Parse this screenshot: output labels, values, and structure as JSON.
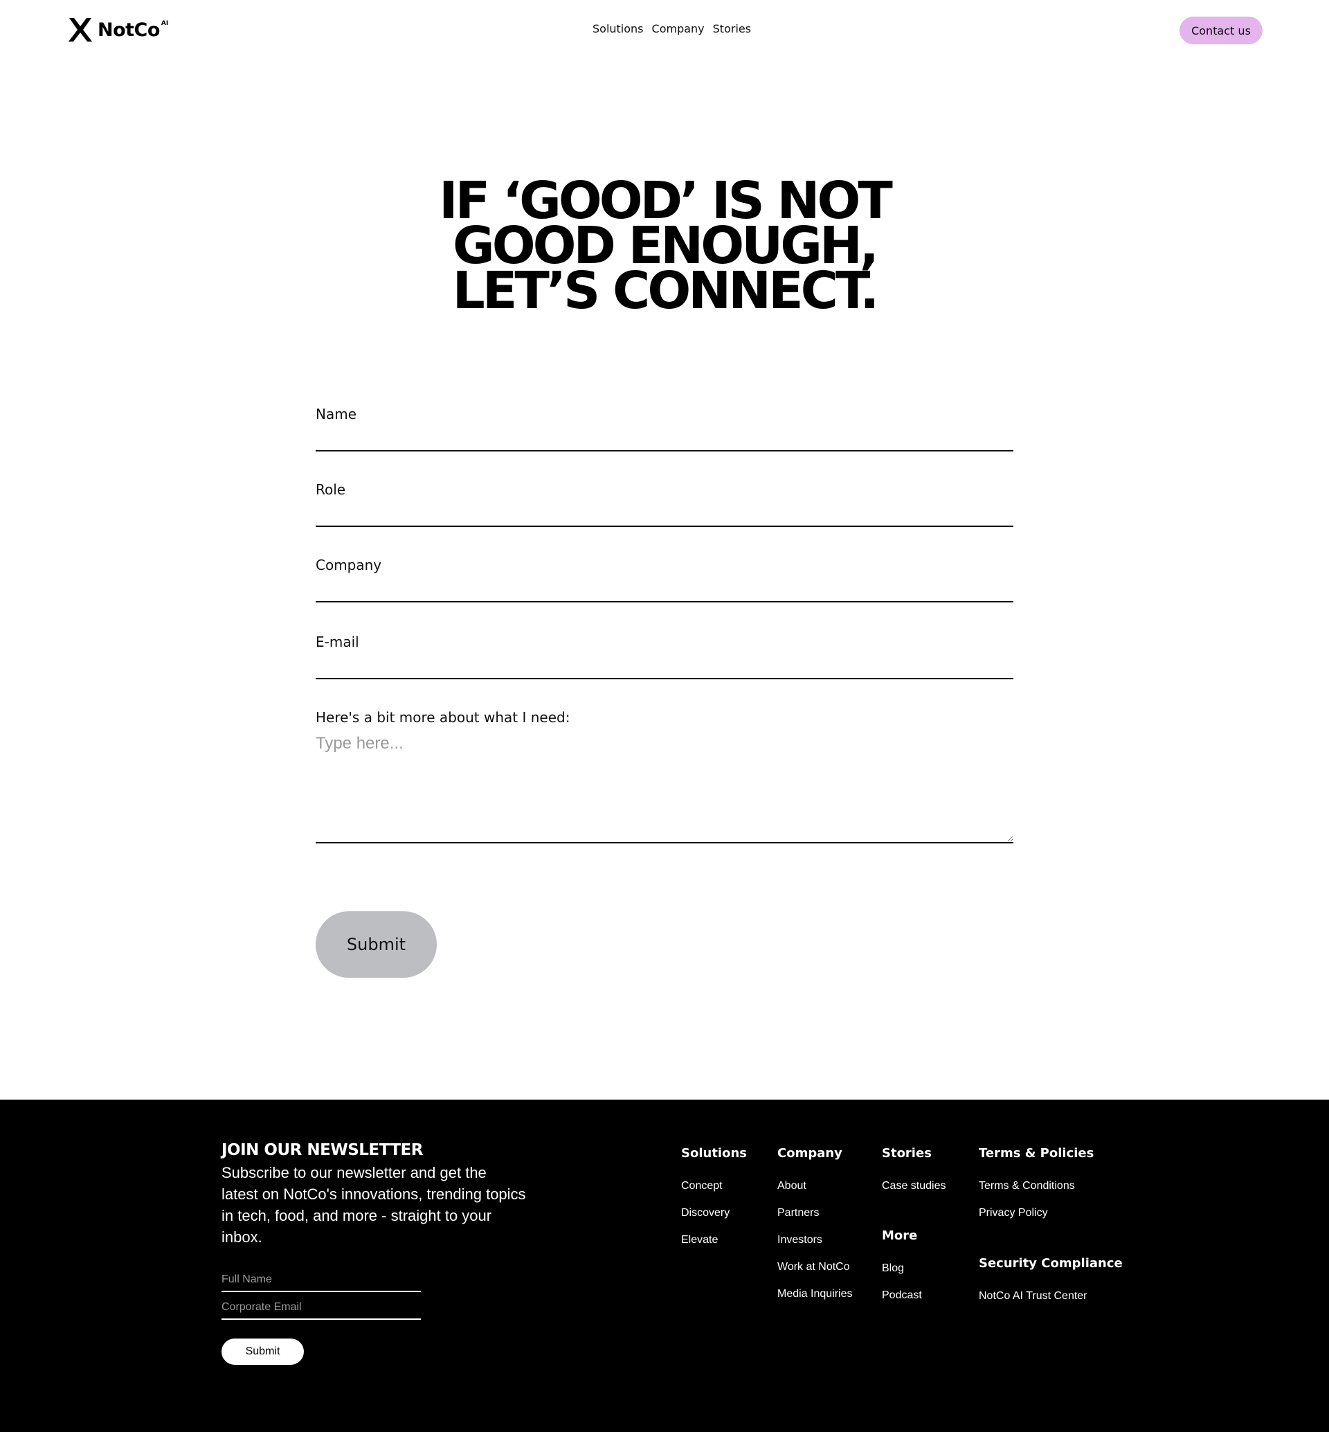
{
  "header": {
    "brand": "NotCo",
    "brand_sup": "AI",
    "nav": [
      "Solutions",
      "Company",
      "Stories"
    ],
    "contact_label": "Contact us"
  },
  "hero": {
    "line1": "IF ‘GOOD’ IS NOT",
    "line2": "GOOD ENOUGH,",
    "line3": "LET’S CONNECT."
  },
  "form": {
    "name_label": "Name",
    "role_label": "Role",
    "company_label": "Company",
    "email_label": "E-mail",
    "message_label": "Here's a bit more about what I need:",
    "message_placeholder": "Type here...",
    "submit_label": "Submit"
  },
  "footer": {
    "newsletter_title": "JOIN OUR NEWSLETTER",
    "newsletter_desc": "Subscribe to our newsletter and get the latest on NotCo's innovations, trending topics in tech, food, and more - straight to your inbox.",
    "fullname_placeholder": "Full Name",
    "email_placeholder": "Corporate Email",
    "submit_label": "Submit",
    "columns": {
      "solutions": {
        "title": "Solutions",
        "links": [
          "Concept",
          "Discovery",
          "Elevate"
        ]
      },
      "company": {
        "title": "Company",
        "links": [
          "About",
          "Partners",
          "Investors",
          "Work at NotCo",
          "Media Inquiries"
        ]
      },
      "stories": {
        "title": "Stories",
        "links": [
          "Case studies"
        ]
      },
      "more": {
        "title": "More",
        "links": [
          "Blog",
          "Podcast"
        ]
      },
      "terms": {
        "title": "Terms & Policies",
        "links": [
          "Terms & Conditions",
          "Privacy Policy"
        ]
      },
      "security": {
        "title": "Security Compliance",
        "links": [
          "NotCo AI Trust Center"
        ]
      }
    }
  },
  "colors": {
    "contact_button": "#e4b4ec",
    "submit_button": "#bdbec2",
    "footer_bg": "#000000"
  }
}
